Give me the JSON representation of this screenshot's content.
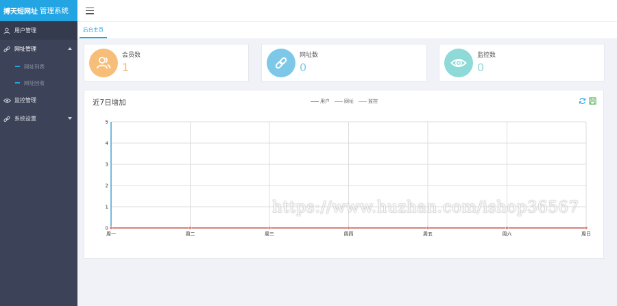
{
  "app": {
    "logo_bold": "搏天短网址",
    "logo_name": "管理系统"
  },
  "sidebar": {
    "items": [
      {
        "label": "用户管理"
      },
      {
        "label": "网址管理",
        "sub": [
          {
            "label": "网址列表"
          },
          {
            "label": "网址回收"
          }
        ]
      },
      {
        "label": "监控管理"
      },
      {
        "label": "系统设置"
      }
    ]
  },
  "tabs": [
    {
      "label": "后台主页"
    }
  ],
  "stats": [
    {
      "label": "会员数",
      "value": "1",
      "color": "#f7be7a",
      "value_color": "#f5b66b",
      "icon": "users-icon"
    },
    {
      "label": "网址数",
      "value": "0",
      "color": "#7dc8e8",
      "value_color": "#7fcbe6",
      "icon": "link-icon"
    },
    {
      "label": "监控数",
      "value": "0",
      "color": "#8ddad8",
      "value_color": "#8fd9d6",
      "icon": "eye-icon"
    }
  ],
  "chart_data": {
    "type": "line",
    "title": "近7日增加",
    "categories": [
      "周一",
      "周二",
      "周三",
      "周四",
      "周五",
      "周六",
      "周日"
    ],
    "series": [
      {
        "name": "用户",
        "values": [
          0,
          0,
          0,
          0,
          0,
          0,
          0
        ],
        "color": "#ee6a5b"
      },
      {
        "name": "网址",
        "values": [
          0,
          0,
          0,
          0,
          0,
          0,
          0
        ],
        "color": "#6cbde6"
      },
      {
        "name": "监控",
        "values": [
          0,
          0,
          0,
          0,
          0,
          0,
          0
        ],
        "color": "#6fd0c8"
      }
    ],
    "ylim": [
      0,
      5
    ],
    "yticks": [
      0,
      1,
      2,
      3,
      4,
      5
    ],
    "grid": true,
    "legend": "top-center"
  },
  "watermark": "https://www.huzhan.com/ishop36567"
}
